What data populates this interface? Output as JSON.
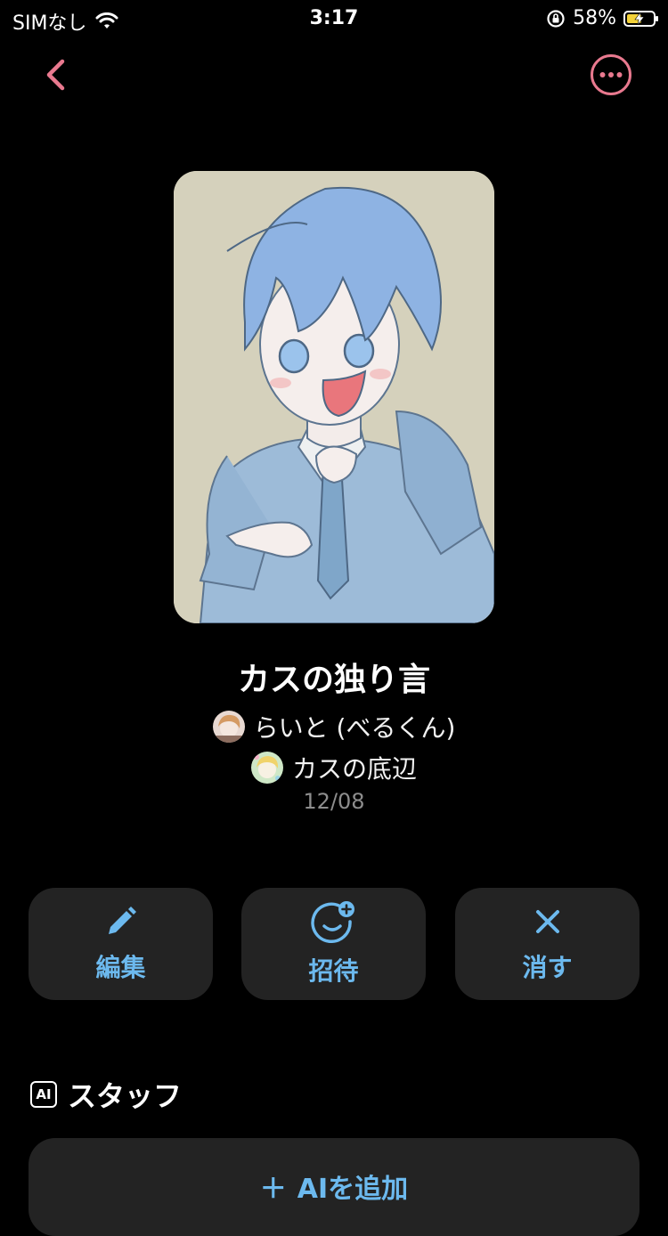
{
  "status_bar": {
    "carrier": "SIMなし",
    "time": "3:17",
    "battery": "58%",
    "battery_level": 0.58
  },
  "nav": {
    "back_icon": "chevron-left-icon",
    "more_icon": "more-circle-icon",
    "accent_color": "#e9798f"
  },
  "track": {
    "title": "カスの独り言",
    "owner": "らいと (べるくん)",
    "circle": "カスの底辺",
    "date": "12/08"
  },
  "actions": {
    "edit": "編集",
    "invite": "招待",
    "delete": "消す",
    "color": "#6cb9ee"
  },
  "staff": {
    "heading": "スタッフ",
    "badge": "AI",
    "add_label": "AIを追加",
    "add_icon_text": "＋"
  }
}
